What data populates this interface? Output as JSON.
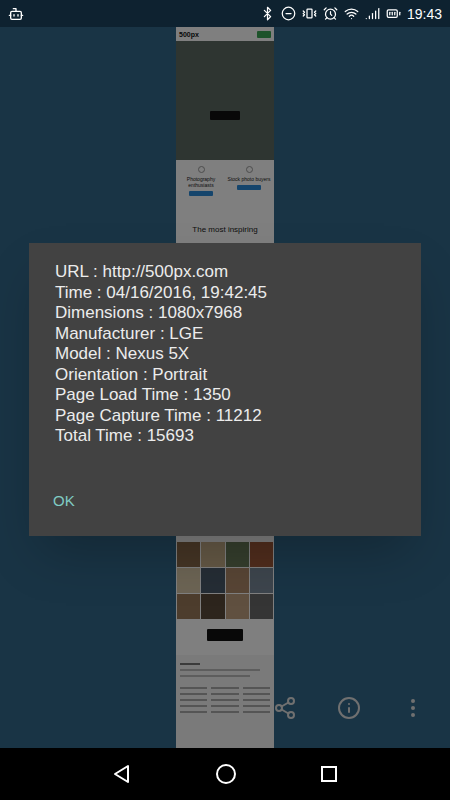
{
  "status_bar": {
    "time": "19:43"
  },
  "capture_preview": {
    "logo": "500px",
    "sections": [
      "Photography enthusiasts",
      "Stock photo buyers"
    ],
    "heading": "The most inspiring"
  },
  "dialog": {
    "lines": [
      "URL : http://500px.com",
      "Time : 04/16/2016, 19:42:45",
      "Dimensions : 1080x7968",
      "Manufacturer : LGE",
      "Model : Nexus 5X",
      "Orientation : Portrait",
      "Page Load Time : 1350",
      "Page Capture Time : 11212",
      "Total Time : 15693"
    ],
    "buttons": [
      "OK"
    ]
  }
}
